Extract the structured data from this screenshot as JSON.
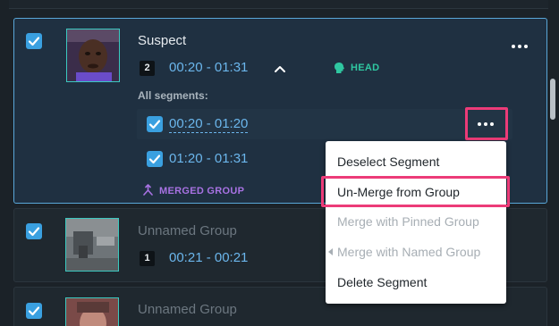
{
  "groups": [
    {
      "name": "Suspect",
      "badge_count": "2",
      "time_range": "00:20 - 01:31",
      "tag": "HEAD",
      "all_segments_label": "All segments:",
      "segments": [
        "00:20 - 01:20",
        "01:20 - 01:31"
      ],
      "merged_label": "MERGED GROUP"
    },
    {
      "name": "Unnamed Group",
      "badge_count": "1",
      "time_range": "00:21 - 00:21"
    },
    {
      "name": "Unnamed Group"
    }
  ],
  "context_menu": {
    "items": [
      {
        "label": "Deselect Segment",
        "enabled": true
      },
      {
        "label": "Un-Merge from Group",
        "enabled": true,
        "highlighted": true
      },
      {
        "label": "Merge with Pinned Group",
        "enabled": false
      },
      {
        "label": "Merge with Named Group",
        "enabled": false,
        "has_submenu": true
      },
      {
        "label": "Delete Segment",
        "enabled": true
      }
    ]
  },
  "colors": {
    "accent_blue": "#3aa0e0",
    "time_blue": "#6bb6ec",
    "head_green": "#2fc7a1",
    "merged_purple": "#a872e3",
    "highlight_pink": "#ec3b78"
  },
  "icons": [
    "checkbox-icon",
    "chevron-up-icon",
    "head-icon",
    "more-icon",
    "merge-icon",
    "caret-left-icon"
  ]
}
